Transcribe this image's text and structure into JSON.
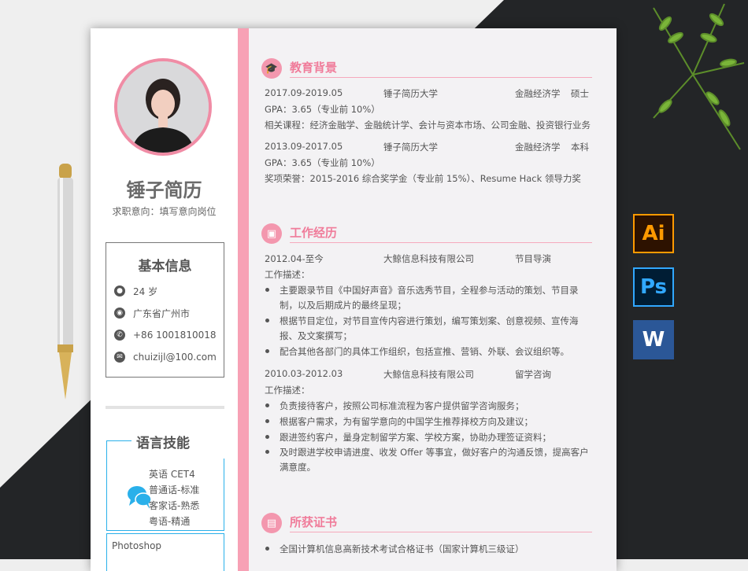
{
  "profile": {
    "name": "锤子简历",
    "intent": "求职意向：填写意向岗位"
  },
  "basic_info": {
    "title": "基本信息",
    "items": [
      {
        "icon": "person-icon",
        "text": "24 岁"
      },
      {
        "icon": "location-icon",
        "text": "广东省广州市"
      },
      {
        "icon": "phone-icon",
        "text": "+86 1001810018"
      },
      {
        "icon": "email-icon",
        "text": "chuizijl@100.com"
      }
    ]
  },
  "languages": {
    "title": "语言技能",
    "items": [
      "英语 CET4",
      "普通话-标准",
      "客家话-熟悉",
      "粤语-精通"
    ]
  },
  "software": {
    "item": "Photoshop"
  },
  "education": {
    "title": "教育背景",
    "entries": [
      {
        "date": "2017.09-2019.05",
        "school": "锤子简历大学",
        "major": "金融经济学",
        "degree": "硕士",
        "gpa": "GPA：3.65（专业前 10%）",
        "extra": "相关课程：经济金融学、金融统计学、会计与资本市场、公司金融、投资银行业务"
      },
      {
        "date": "2013.09-2017.05",
        "school": "锤子简历大学",
        "major": "金融经济学",
        "degree": "本科",
        "gpa": "GPA：3.65（专业前 10%）",
        "extra": "奖项荣誉：2015-2016 综合奖学金（专业前 15%）、Resume Hack 领导力奖"
      }
    ]
  },
  "work": {
    "title": "工作经历",
    "entries": [
      {
        "date": "2012.04-至今",
        "company": "大鲸信息科技有限公司",
        "role": "节目导演",
        "desc_label": "工作描述：",
        "bullets": [
          "主要跟录节目《中国好声音》音乐选秀节目，全程参与活动的策划、节目录制，以及后期成片的最终呈现；",
          "根据节目定位，对节目宣传内容进行策划，编写策划案、创意视频、宣传海报、及文案撰写；",
          "配合其他各部门的具体工作组织，包括宣推、营销、外联、会议组织等。"
        ]
      },
      {
        "date": "2010.03-2012.03",
        "company": "大鲸信息科技有限公司",
        "role": "留学咨询",
        "desc_label": "工作描述：",
        "bullets": [
          "负责接待客户，按照公司标准流程为客户提供留学咨询服务；",
          "根据客户需求，为有留学意向的中国学生推荐择校方向及建议；",
          "跟进签约客户，量身定制留学方案、学校方案，协助办理签证资料；",
          "及时跟进学校申请进度、收发 Offer 等事宜，做好客户的沟通反馈，提高客户满意度。"
        ]
      }
    ]
  },
  "certificates": {
    "title": "所获证书",
    "items": [
      "全国计算机信息高新技术考试合格证书（国家计算机三级证）"
    ]
  },
  "app_icons": {
    "ai": "Ai",
    "ps": "Ps",
    "word": "W"
  },
  "colors": {
    "accent_pink": "#f07c9a",
    "accent_blue": "#2ab0ea"
  }
}
